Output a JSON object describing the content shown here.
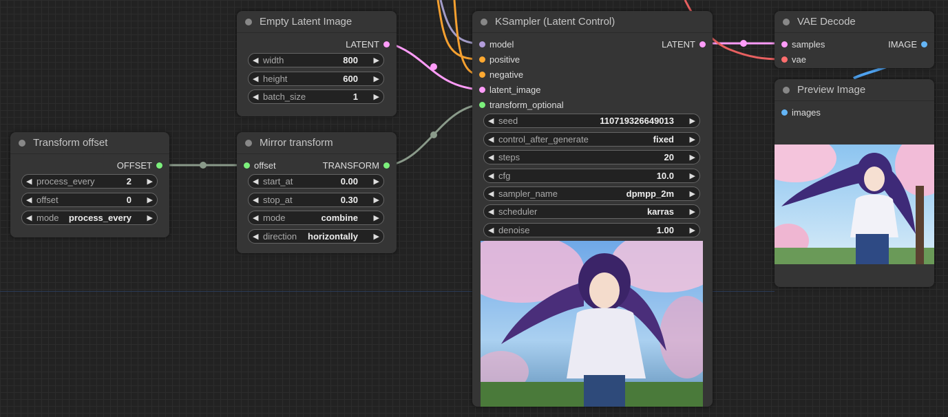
{
  "nodes": {
    "empty_latent": {
      "title": "Empty Latent Image",
      "output": "LATENT",
      "widgets": [
        {
          "label": "width",
          "value": "800"
        },
        {
          "label": "height",
          "value": "600"
        },
        {
          "label": "batch_size",
          "value": "1"
        }
      ]
    },
    "transform_offset": {
      "title": "Transform offset",
      "output": "OFFSET",
      "widgets": [
        {
          "label": "process_every",
          "value": "2"
        },
        {
          "label": "offset",
          "value": "0"
        },
        {
          "label": "mode",
          "value": "process_every"
        }
      ]
    },
    "mirror_transform": {
      "title": "Mirror transform",
      "input": "offset",
      "output": "TRANSFORM",
      "widgets": [
        {
          "label": "start_at",
          "value": "0.00"
        },
        {
          "label": "stop_at",
          "value": "0.30"
        },
        {
          "label": "mode",
          "value": "combine"
        },
        {
          "label": "direction",
          "value": "horizontally"
        }
      ]
    },
    "ksampler": {
      "title": "KSampler (Latent Control)",
      "inputs": [
        "model",
        "positive",
        "negative",
        "latent_image",
        "transform_optional"
      ],
      "output": "LATENT",
      "widgets": [
        {
          "label": "seed",
          "value": "110719326649013"
        },
        {
          "label": "control_after_generate",
          "value": "fixed"
        },
        {
          "label": "steps",
          "value": "20"
        },
        {
          "label": "cfg",
          "value": "10.0"
        },
        {
          "label": "sampler_name",
          "value": "dpmpp_2m"
        },
        {
          "label": "scheduler",
          "value": "karras"
        },
        {
          "label": "denoise",
          "value": "1.00"
        }
      ]
    },
    "vae_decode": {
      "title": "VAE Decode",
      "inputs": [
        "samples",
        "vae"
      ],
      "output": "IMAGE"
    },
    "preview_image": {
      "title": "Preview Image",
      "input": "images"
    }
  },
  "colors": {
    "model": "#b39ddb",
    "conditioning": "#ffa931",
    "latent": "#ff9cf9",
    "transform": "#7cf07c",
    "vae": "#ff6e6e",
    "image": "#64b5f6",
    "link_transform": "#8a9a8a"
  }
}
